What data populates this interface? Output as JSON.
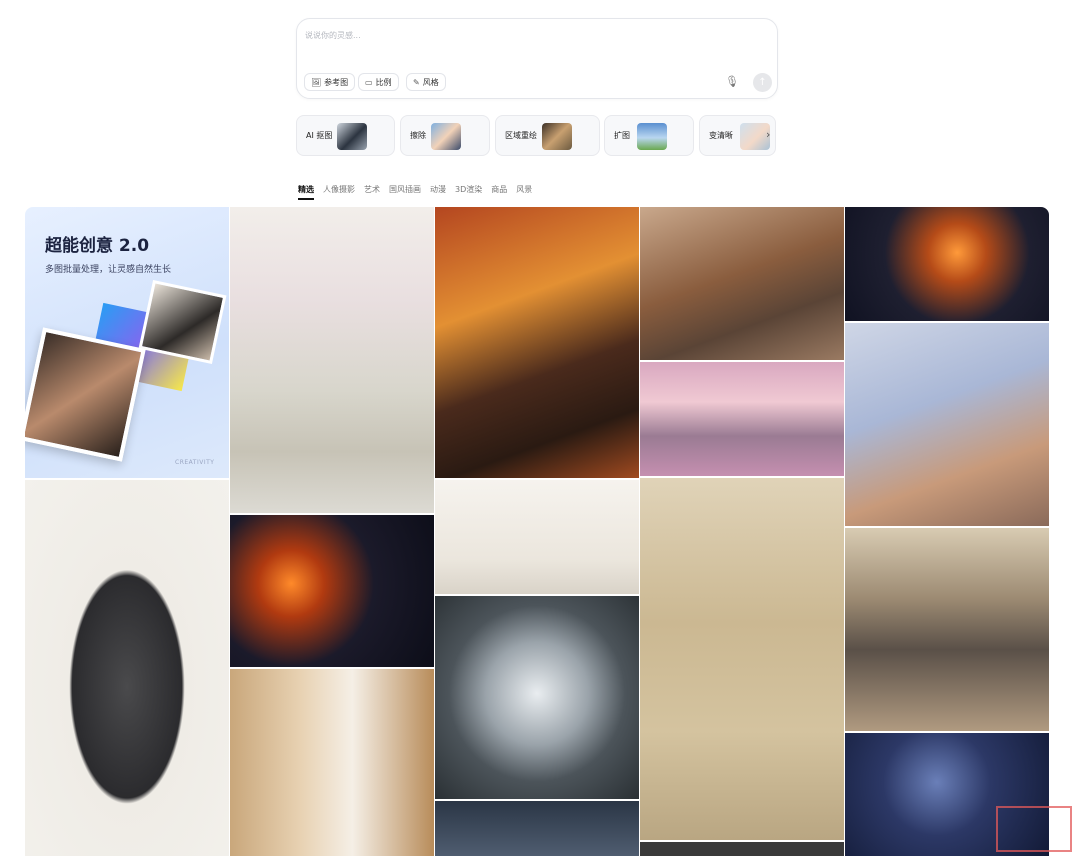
{
  "prompt": {
    "placeholder": "说说你的灵感..."
  },
  "toolbar": [
    {
      "label": "参考图",
      "icon": "image-icon"
    },
    {
      "label": "比例",
      "icon": "ratio-icon"
    },
    {
      "label": "风格",
      "icon": "brush-icon"
    }
  ],
  "features": [
    {
      "label": "AI 抠图"
    },
    {
      "label": "擦除"
    },
    {
      "label": "区域重绘"
    },
    {
      "label": "扩图"
    },
    {
      "label": "变清晰"
    }
  ],
  "tabs": [
    "精选",
    "人像摄影",
    "艺术",
    "国风插画",
    "动漫",
    "3D渲染",
    "商品",
    "风景"
  ],
  "promo": {
    "title": "超能创意 2.0",
    "subtitle": "多图批量处理，让灵感自然生长",
    "brand": "CREATIVITY"
  },
  "colors": {
    "accent": "#111111",
    "promo_bg": "#dce9ff"
  }
}
